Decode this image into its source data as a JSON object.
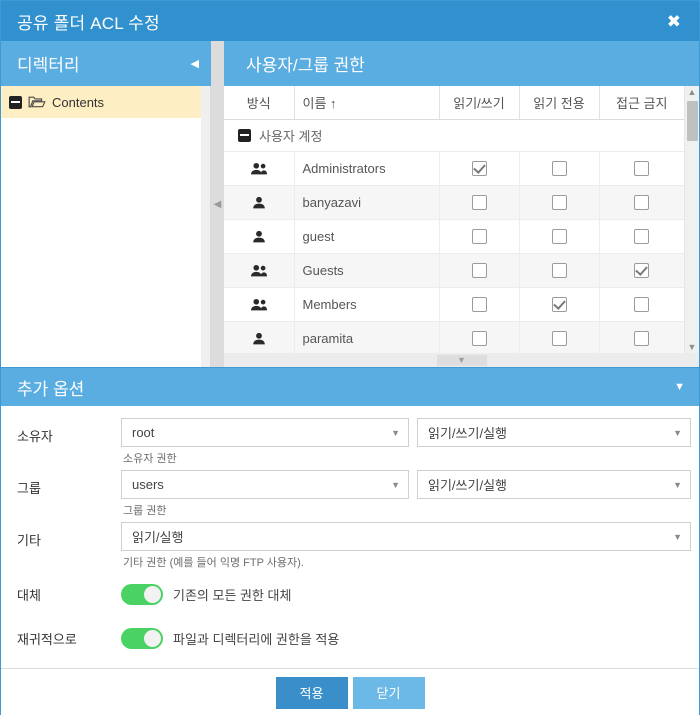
{
  "window": {
    "title": "공유 폴더 ACL 수정",
    "close_icon": "close-icon"
  },
  "directory_pane": {
    "header": "디렉터리",
    "collapse_icon": "chevron-left-icon",
    "tree": [
      {
        "label": "Contents",
        "expander": "minus-box-icon",
        "icon": "folder-open-icon",
        "selected": true
      }
    ]
  },
  "permissions_pane": {
    "header": "사용자/그룹 권한",
    "columns": [
      "방식",
      "이름 ↑",
      "읽기/쓰기",
      "읽기 전용",
      "접근 금지"
    ],
    "group_header": {
      "label": "사용자 계정",
      "expander": "minus-box-icon"
    },
    "rows": [
      {
        "icon": "group-icon",
        "name": "Administrators",
        "read_write": true,
        "read_only": false,
        "no_access": false
      },
      {
        "icon": "person-icon",
        "name": "banyazavi",
        "read_write": false,
        "read_only": false,
        "no_access": false
      },
      {
        "icon": "person-icon",
        "name": "guest",
        "read_write": false,
        "read_only": false,
        "no_access": false
      },
      {
        "icon": "group-icon",
        "name": "Guests",
        "read_write": false,
        "read_only": false,
        "no_access": true
      },
      {
        "icon": "group-icon",
        "name": "Members",
        "read_write": false,
        "read_only": true,
        "no_access": false
      },
      {
        "icon": "person-icon",
        "name": "paramita",
        "read_write": false,
        "read_only": false,
        "no_access": false
      }
    ]
  },
  "additional_options": {
    "header": "추가 옵션",
    "collapse_icon": "chevron-down-icon",
    "owner": {
      "label": "소유자",
      "principal": "root",
      "permission": "읽기/쓰기/실행",
      "hint": "소유자 권한"
    },
    "group": {
      "label": "그룹",
      "principal": "users",
      "permission": "읽기/쓰기/실행",
      "hint": "그룹 권한"
    },
    "other": {
      "label": "기타",
      "permission": "읽기/실행",
      "hint": "기타 권한 (예를 들어 익명 FTP 사용자)."
    },
    "replace": {
      "label": "대체",
      "switch_label": "기존의 모든 권한 대체",
      "on": true
    },
    "recursive": {
      "label": "재귀적으로",
      "switch_label": "파일과 디렉터리에 권한을 적용",
      "on": true
    }
  },
  "footer": {
    "apply": "적용",
    "close": "닫기"
  },
  "colors": {
    "titlebar": "#3191ce",
    "section_header": "#5aade1",
    "selected_tree_row": "#fdeec3",
    "toggle_on": "#4ad263",
    "primary_button": "#3a8fca",
    "secondary_button": "#6cb8e6"
  }
}
